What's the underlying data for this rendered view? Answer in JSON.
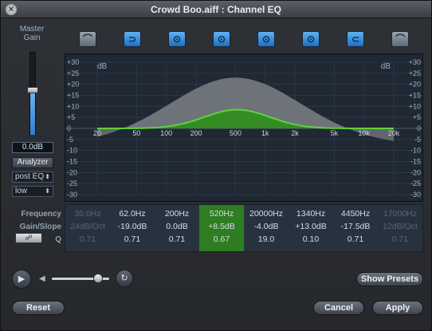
{
  "window": {
    "title": "Crowd Boo.aiff : Channel EQ"
  },
  "master": {
    "label_line1": "Master",
    "label_line2": "Gain",
    "value": "0.0dB",
    "level": 0.55
  },
  "analyzer": {
    "label": "Analyzer",
    "mode": "post EQ",
    "resolution": "low"
  },
  "bands": [
    {
      "name": "low-cut",
      "on": false,
      "glyph": "⌒"
    },
    {
      "name": "low-shelf",
      "on": true,
      "glyph": "⊃"
    },
    {
      "name": "peak-1",
      "on": true,
      "glyph": "⊙"
    },
    {
      "name": "peak-2",
      "on": true,
      "glyph": "⊙"
    },
    {
      "name": "peak-3",
      "on": true,
      "glyph": "⊙"
    },
    {
      "name": "peak-4",
      "on": true,
      "glyph": "⊙"
    },
    {
      "name": "high-shelf",
      "on": true,
      "glyph": "⊂"
    },
    {
      "name": "high-cut",
      "on": false,
      "glyph": "⌒"
    }
  ],
  "graph": {
    "db_label": "dB",
    "db_ticks": [
      "+30",
      "+25",
      "+20",
      "+15",
      "+10",
      "+5",
      "0",
      "-5",
      "-10",
      "-15",
      "-20",
      "-25",
      "-30"
    ],
    "freq_ticks": [
      "20",
      "50",
      "100",
      "200",
      "500",
      "1k",
      "2k",
      "5k",
      "10k",
      "20k"
    ]
  },
  "params": {
    "frequency_label": "Frequency",
    "gain_label": "Gain/Slope",
    "q_label": "Q",
    "link_label": "☍",
    "columns": [
      {
        "freq": "30.0Hz",
        "gain": "24dB/Oct",
        "q": "0.71",
        "dim": true,
        "active": false
      },
      {
        "freq": "62.0Hz",
        "gain": "-19.0dB",
        "q": "0.71",
        "dim": false,
        "active": false
      },
      {
        "freq": "200Hz",
        "gain": "0.0dB",
        "q": "0.71",
        "dim": false,
        "active": false
      },
      {
        "freq": "520Hz",
        "gain": "+8.5dB",
        "q": "0.67",
        "dim": false,
        "active": true
      },
      {
        "freq": "20000Hz",
        "gain": "-4.0dB",
        "q": "19.0",
        "dim": false,
        "active": false
      },
      {
        "freq": "1340Hz",
        "gain": "+13.0dB",
        "q": "0.10",
        "dim": false,
        "active": false
      },
      {
        "freq": "4450Hz",
        "gain": "-17.5dB",
        "q": "0.71",
        "dim": false,
        "active": false
      },
      {
        "freq": "17000Hz",
        "gain": "12dB/Oct",
        "q": "0.71",
        "dim": true,
        "active": false
      }
    ]
  },
  "transport": {
    "volume": 0.8
  },
  "buttons": {
    "show_presets": "Show Presets",
    "reset": "Reset",
    "cancel": "Cancel",
    "apply": "Apply"
  }
}
